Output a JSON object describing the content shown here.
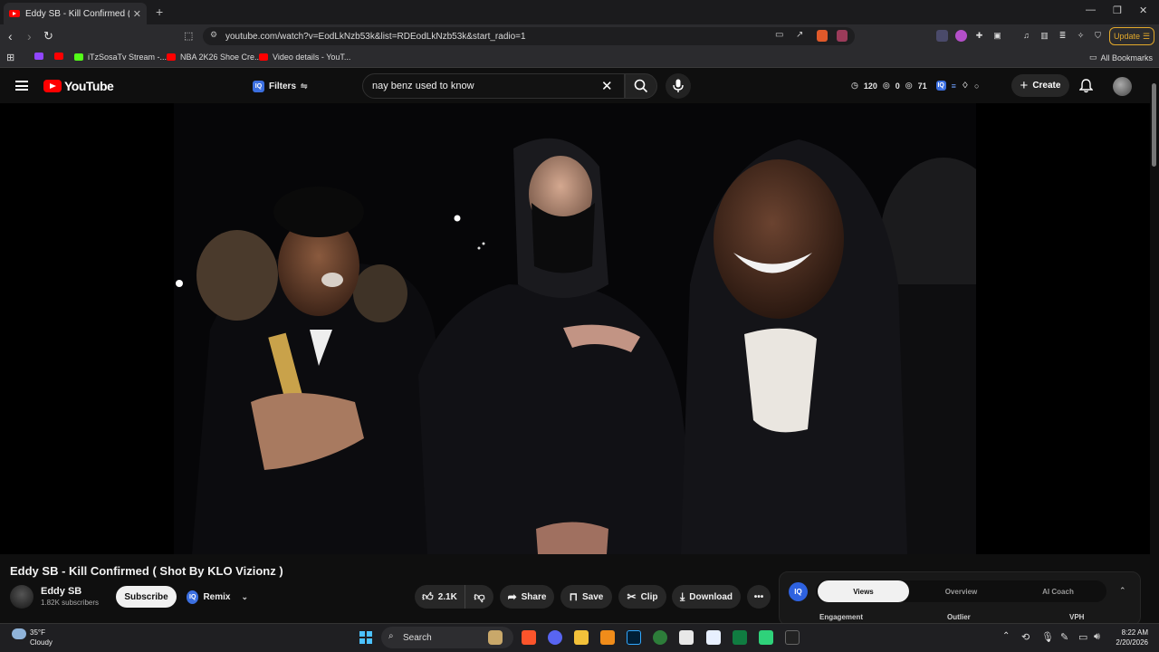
{
  "browser": {
    "tab_title": "Eddy SB - Kill Confirmed ( Sho",
    "url": "youtube.com/watch?v=EodLkNzb53k&list=RDEodLkNzb53k&start_radio=1",
    "update_label": "Update",
    "bookmarks": [
      {
        "label": "iTzSosaTv Stream -..."
      },
      {
        "label": "NBA 2K26 Shoe Cre..."
      },
      {
        "label": "Video details - YouT..."
      }
    ],
    "all_bookmarks_label": "All Bookmarks"
  },
  "youtube": {
    "logo_text": "YouTube",
    "filters_label": "Filters",
    "search_query": "nay benz used to know",
    "stats": {
      "views": "120",
      "zero": "0",
      "likes": "71"
    },
    "create_label": "Create"
  },
  "video": {
    "title": "Eddy SB - Kill Confirmed ( Shot By KLO Vizionz )",
    "channel_name": "Eddy SB",
    "subscribers": "1.82K subscribers",
    "subscribe_label": "Subscribe",
    "remix_label": "Remix",
    "like_count": "2.1K",
    "share_label": "Share",
    "save_label": "Save",
    "clip_label": "Clip",
    "download_label": "Download"
  },
  "panel": {
    "iq_label": "IQ",
    "tabs": [
      "Views",
      "Overview",
      "AI Coach"
    ],
    "active_tab": "Views",
    "columns": [
      "Engagement",
      "Outlier",
      "VPH"
    ]
  },
  "taskbar": {
    "weather_temp": "35°F",
    "weather_desc": "Cloudy",
    "search_label": "Search",
    "time": "8:22 AM",
    "date": "2/20/2026"
  },
  "colors": {
    "brand": "#ff0000",
    "accent": "#3b6fe0",
    "update": "#e3a92b"
  }
}
